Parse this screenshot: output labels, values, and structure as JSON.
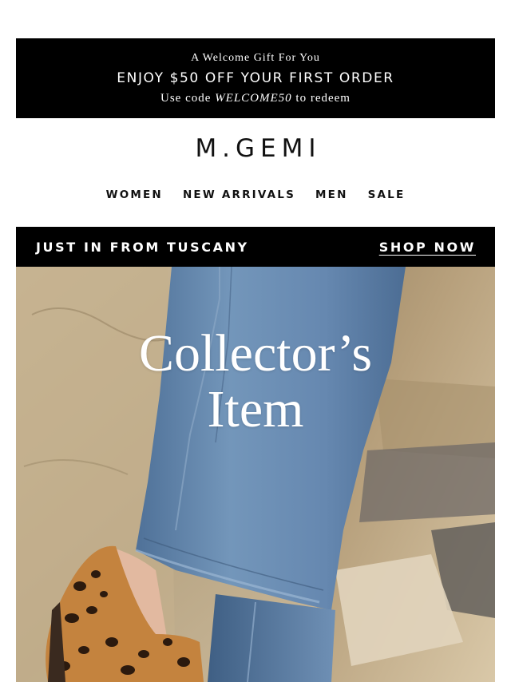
{
  "promo": {
    "line1": "A Welcome Gift For You",
    "line2": "ENJOY $50 OFF YOUR FIRST ORDER",
    "line3_prefix": "Use code ",
    "line3_code": "WELCOME50",
    "line3_suffix": " to redeem"
  },
  "brand": {
    "logo_text": "M.GEMI"
  },
  "nav": {
    "items": [
      {
        "label": "WOMEN"
      },
      {
        "label": "NEW ARRIVALS"
      },
      {
        "label": "MEN"
      },
      {
        "label": "SALE"
      }
    ]
  },
  "banner": {
    "left_text": "JUST IN FROM TUSCANY",
    "cta_text": "SHOP NOW"
  },
  "hero": {
    "title_line1": "Collector’s",
    "title_line2": "Item"
  },
  "colors": {
    "black": "#000000",
    "white": "#ffffff",
    "denim": "#5f85ad",
    "stone": "#c7b596"
  }
}
